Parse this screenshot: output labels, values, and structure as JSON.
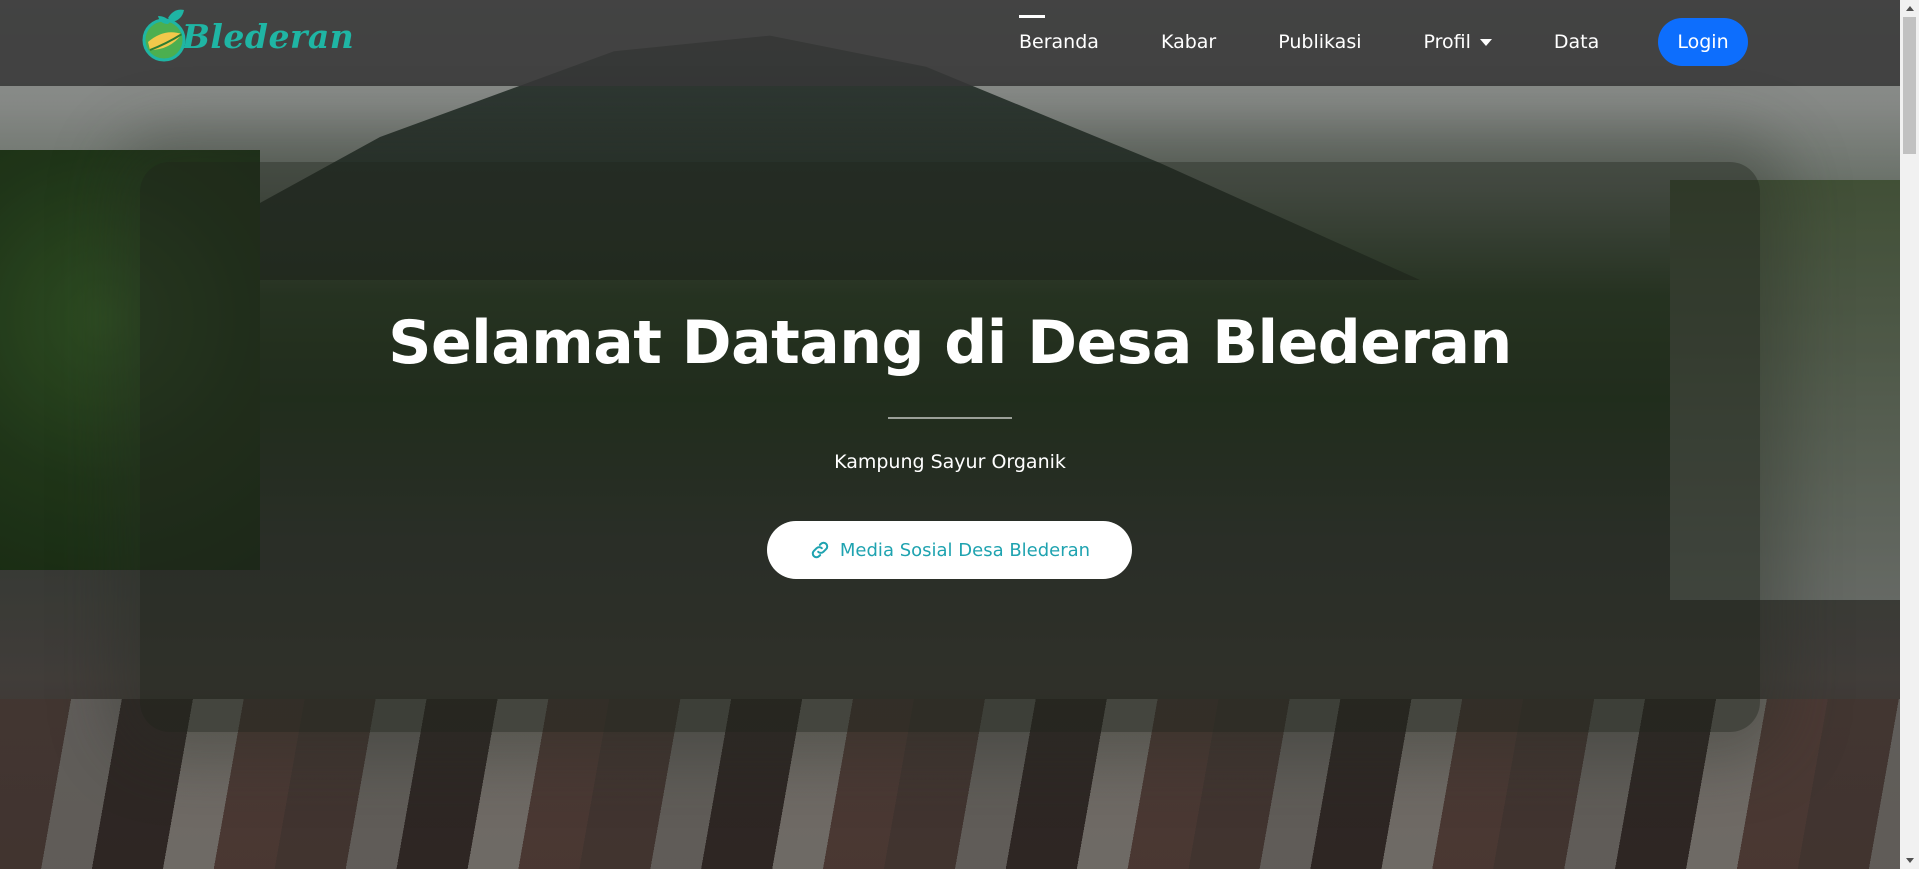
{
  "brand": {
    "name": "Blederan",
    "logo_icon": "leaf-globe-icon",
    "color": "#1fb5a4"
  },
  "nav": {
    "items": [
      {
        "label": "Beranda",
        "active": true
      },
      {
        "label": "Kabar"
      },
      {
        "label": "Publikasi"
      },
      {
        "label": "Profil",
        "dropdown": true
      },
      {
        "label": "Data"
      }
    ],
    "login_label": "Login",
    "login_color": "#0d6efd"
  },
  "hero": {
    "title": "Selamat Datang di Desa Blederan",
    "subtitle": "Kampung Sayur Organik",
    "button_label": "Media Sosial Desa Blederan",
    "button_icon": "link-icon",
    "button_text_color": "#1fa3b0"
  }
}
